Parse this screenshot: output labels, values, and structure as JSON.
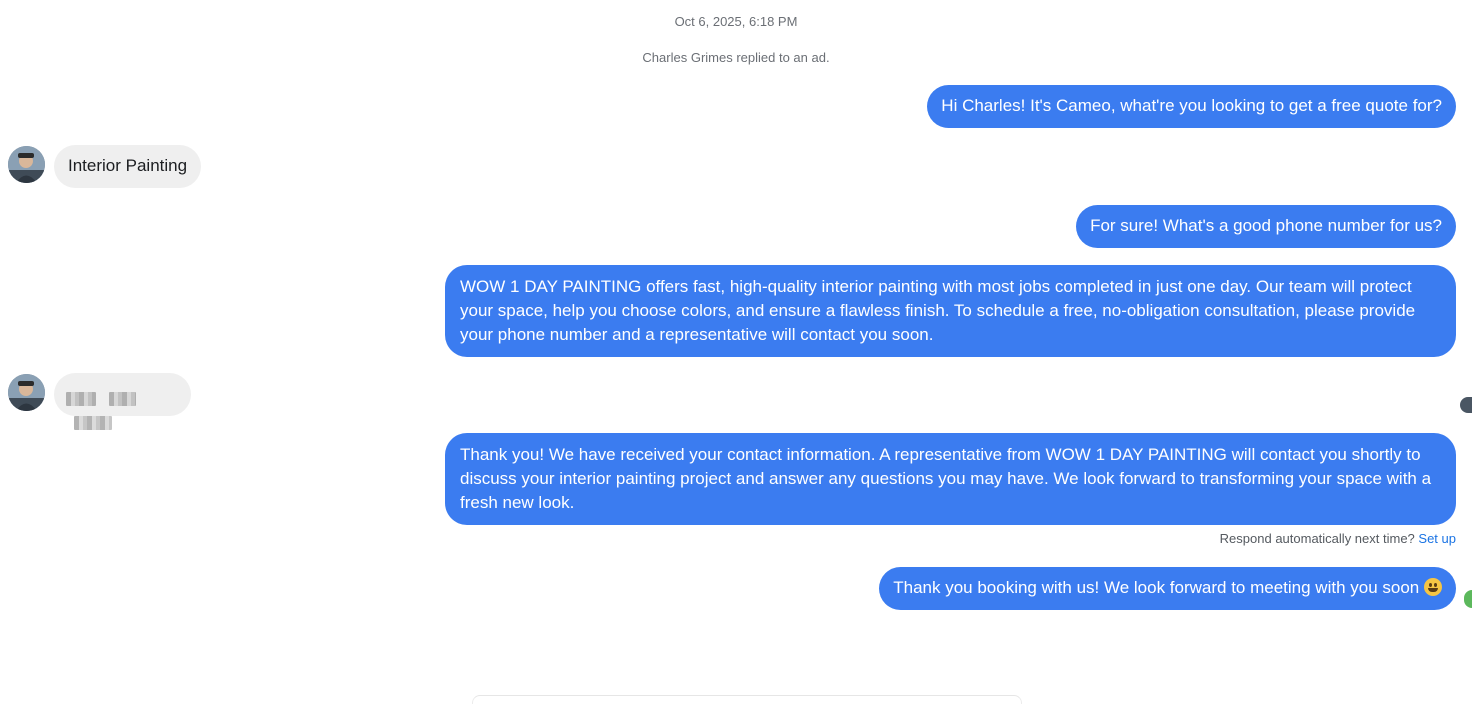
{
  "conversation": {
    "timestamp": "Oct 6, 2025, 6:18 PM",
    "system_note": "Charles Grimes replied to an ad."
  },
  "messages": [
    {
      "from": "business",
      "text": "Hi Charles! It's Cameo, what're you looking to get a free quote for?"
    },
    {
      "from": "customer",
      "text": "Interior Painting"
    },
    {
      "from": "business",
      "text": "For sure! What's a good phone number for us?"
    },
    {
      "from": "business",
      "text": "WOW 1 DAY PAINTING offers fast, high-quality interior painting with most jobs completed in just one day. Our team will protect your space, help you choose colors, and ensure a flawless finish. To schedule a free, no-obligation consultation, please provide your phone number and a representative will contact you soon."
    },
    {
      "from": "customer",
      "text": "",
      "redacted": true
    },
    {
      "from": "business",
      "text": "Thank you! We have received your contact information. A representative from WOW 1 DAY PAINTING will contact you shortly to discuss your interior painting project and answer any questions you may have. We look forward to transforming your space with a fresh new look."
    },
    {
      "from": "business",
      "text": "Thank you booking with us! We look forward to meeting with you soon",
      "emoji": "smiling-face"
    }
  ],
  "auto_respond": {
    "prompt": "Respond automatically next time?",
    "link": "Set up"
  },
  "colors": {
    "outgoing_bubble": "#3b7cf0",
    "incoming_bubble": "#efefef",
    "link": "#1b74e4"
  }
}
